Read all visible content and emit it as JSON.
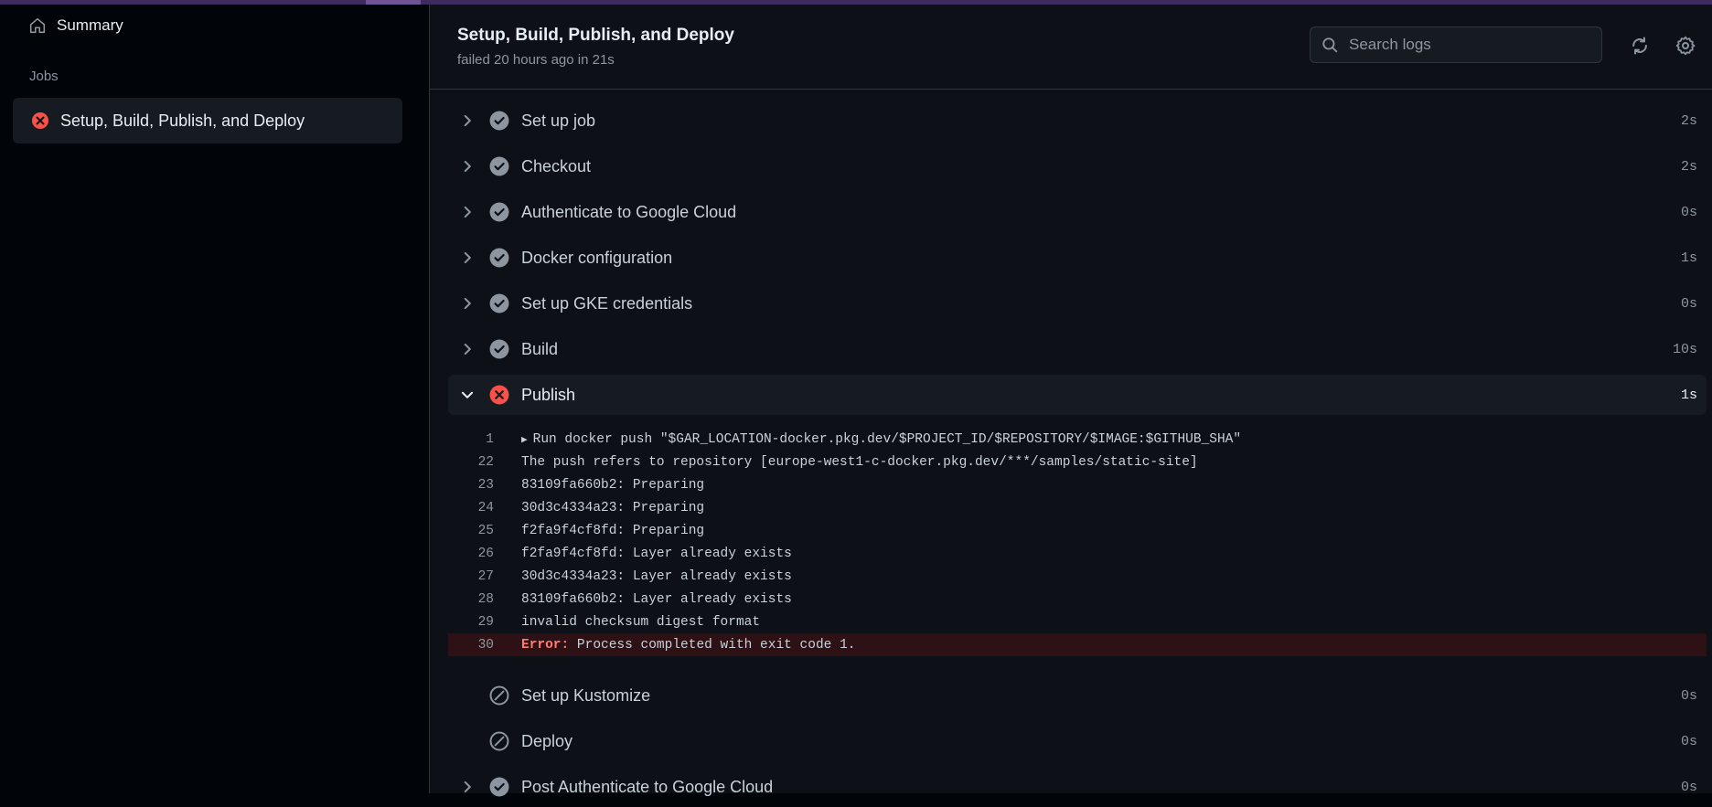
{
  "sidebar": {
    "summary_label": "Summary",
    "jobs_heading": "Jobs",
    "job_label": "Setup, Build, Publish, and Deploy"
  },
  "header": {
    "title": "Setup, Build, Publish, and Deploy",
    "subtitle": "failed 20 hours ago in 21s",
    "search_placeholder": "Search logs"
  },
  "steps": [
    {
      "name": "Set up job",
      "duration": "2s",
      "status": "success"
    },
    {
      "name": "Checkout",
      "duration": "2s",
      "status": "success"
    },
    {
      "name": "Authenticate to Google Cloud",
      "duration": "0s",
      "status": "success"
    },
    {
      "name": "Docker configuration",
      "duration": "1s",
      "status": "success"
    },
    {
      "name": "Set up GKE credentials",
      "duration": "0s",
      "status": "success"
    },
    {
      "name": "Build",
      "duration": "10s",
      "status": "success"
    },
    {
      "name": "Publish",
      "duration": "1s",
      "status": "failure"
    },
    {
      "name": "Set up Kustomize",
      "duration": "0s",
      "status": "skipped"
    },
    {
      "name": "Deploy",
      "duration": "0s",
      "status": "skipped"
    },
    {
      "name": "Post Authenticate to Google Cloud",
      "duration": "0s",
      "status": "success"
    }
  ],
  "logs": [
    {
      "line": "1",
      "text": "Run docker push \"$GAR_LOCATION-docker.pkg.dev/$PROJECT_ID/$REPOSITORY/$IMAGE:$GITHUB_SHA\""
    },
    {
      "line": "22",
      "text": "The push refers to repository [europe-west1-c-docker.pkg.dev/***/samples/static-site]"
    },
    {
      "line": "23",
      "text": "83109fa660b2: Preparing"
    },
    {
      "line": "24",
      "text": "30d3c4334a23: Preparing"
    },
    {
      "line": "25",
      "text": "f2fa9f4cf8fd: Preparing"
    },
    {
      "line": "26",
      "text": "f2fa9f4cf8fd: Layer already exists"
    },
    {
      "line": "27",
      "text": "30d3c4334a23: Layer already exists"
    },
    {
      "line": "28",
      "text": "83109fa660b2: Layer already exists"
    },
    {
      "line": "29",
      "text": "invalid checksum digest format"
    },
    {
      "line": "30",
      "error_label": "Error:",
      "text": " Process completed with exit code 1."
    }
  ],
  "colors": {
    "success": "#8d96a0",
    "failure": "#f85149",
    "background": "#0d1117",
    "error_row": "#2d1115"
  }
}
